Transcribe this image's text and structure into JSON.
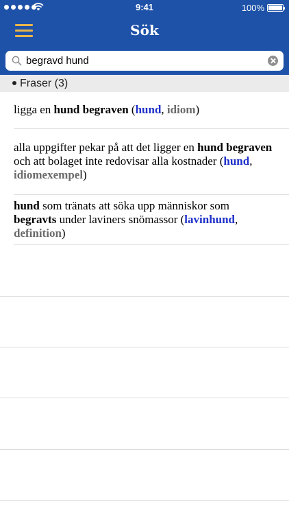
{
  "status": {
    "time": "9:41",
    "battery": "100%"
  },
  "nav": {
    "title": "Sök",
    "menu_icon": "hamburger-menu-icon"
  },
  "search": {
    "value": "begravd hund",
    "placeholder": ""
  },
  "section": {
    "title": "Fraser (3)"
  },
  "results": [
    {
      "parts": [
        {
          "text": "ligga en "
        },
        {
          "text": "hund begraven",
          "style": "b"
        },
        {
          "text": " ("
        },
        {
          "text": "hund",
          "style": "blue"
        },
        {
          "text": ", "
        },
        {
          "text": "idiom",
          "style": "gray"
        },
        {
          "text": ")"
        }
      ]
    },
    {
      "parts": [
        {
          "text": "alla uppgifter pekar på att det ligger en "
        },
        {
          "text": "hund begraven",
          "style": "b"
        },
        {
          "text": " och att bolaget inte redovisar alla kostnader ("
        },
        {
          "text": "hund",
          "style": "blue"
        },
        {
          "text": ", "
        },
        {
          "text": "idiomexempel",
          "style": "gray"
        },
        {
          "text": ")"
        }
      ]
    },
    {
      "parts": [
        {
          "text": "hund",
          "style": "b"
        },
        {
          "text": " som tränats att söka upp människor som "
        },
        {
          "text": "begravts",
          "style": "b"
        },
        {
          "text": " under laviners snömassor ("
        },
        {
          "text": "lavinhund",
          "style": "blue"
        },
        {
          "text": ", "
        },
        {
          "text": "definition",
          "style": "gray"
        },
        {
          "text": ")"
        }
      ]
    }
  ],
  "colors": {
    "header": "#1e52a8",
    "menu_icon": "#e8b54a",
    "link": "#1f31c8",
    "type_label": "#6a6a6a"
  }
}
